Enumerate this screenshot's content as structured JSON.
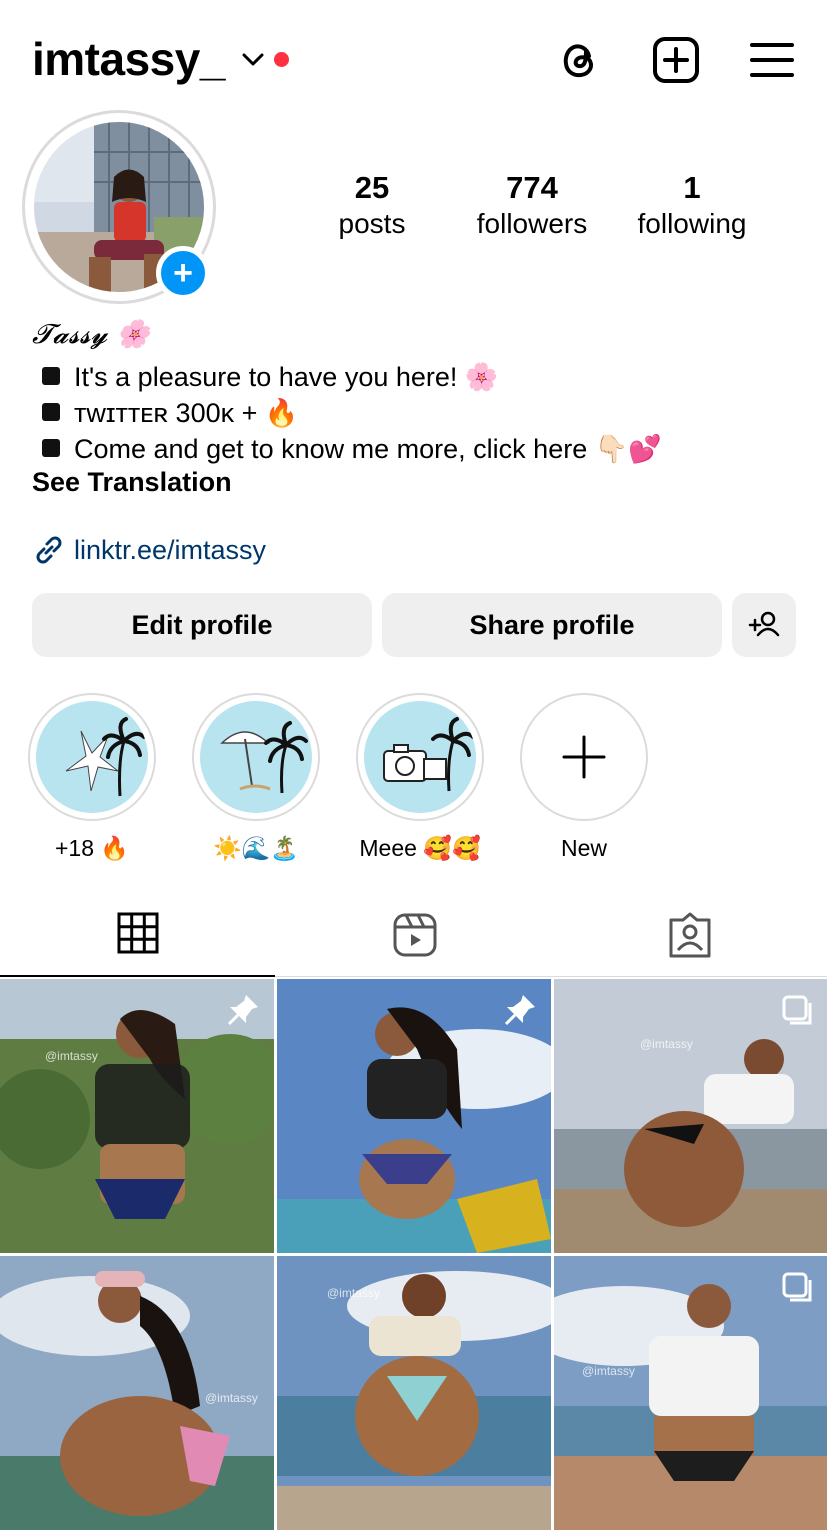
{
  "header": {
    "username": "imtassy_",
    "icons": [
      "chevron-down-icon",
      "threads-icon",
      "create-post-icon",
      "menu-icon"
    ],
    "notification_dot_color": "#ff3040"
  },
  "stats": [
    {
      "value": "25",
      "label": "posts"
    },
    {
      "value": "774",
      "label": "followers"
    },
    {
      "value": "1",
      "label": "following"
    }
  ],
  "bio": {
    "name": "𝓣𝓪𝓼𝓼𝔂 🌸",
    "lines": [
      "It's a pleasure to have you here! 🌸",
      "ᴛᴡɪᴛᴛᴇʀ 300ᴋ + 🔥",
      "Come and get to know me more, click here 👇🏻💕"
    ],
    "see_translation": "See Translation",
    "link": "linktr.ee/imtassy",
    "link_color": "#00376b"
  },
  "buttons": {
    "edit": "Edit profile",
    "share": "Share profile"
  },
  "highlights": [
    {
      "label": "+18 🔥"
    },
    {
      "label": "☀️🌊🏝️"
    },
    {
      "label": "Meee 🥰🥰"
    },
    {
      "label": "New"
    }
  ],
  "tabs": [
    "grid-icon",
    "reels-icon",
    "tagged-icon"
  ],
  "posts": {
    "watermark": "@imtassy",
    "pinned_count": 2,
    "multi_count": 2
  },
  "colors": {
    "accent": "#0095f6",
    "button_bg": "#efefef",
    "highlight_bg": "#b8e4f0"
  }
}
